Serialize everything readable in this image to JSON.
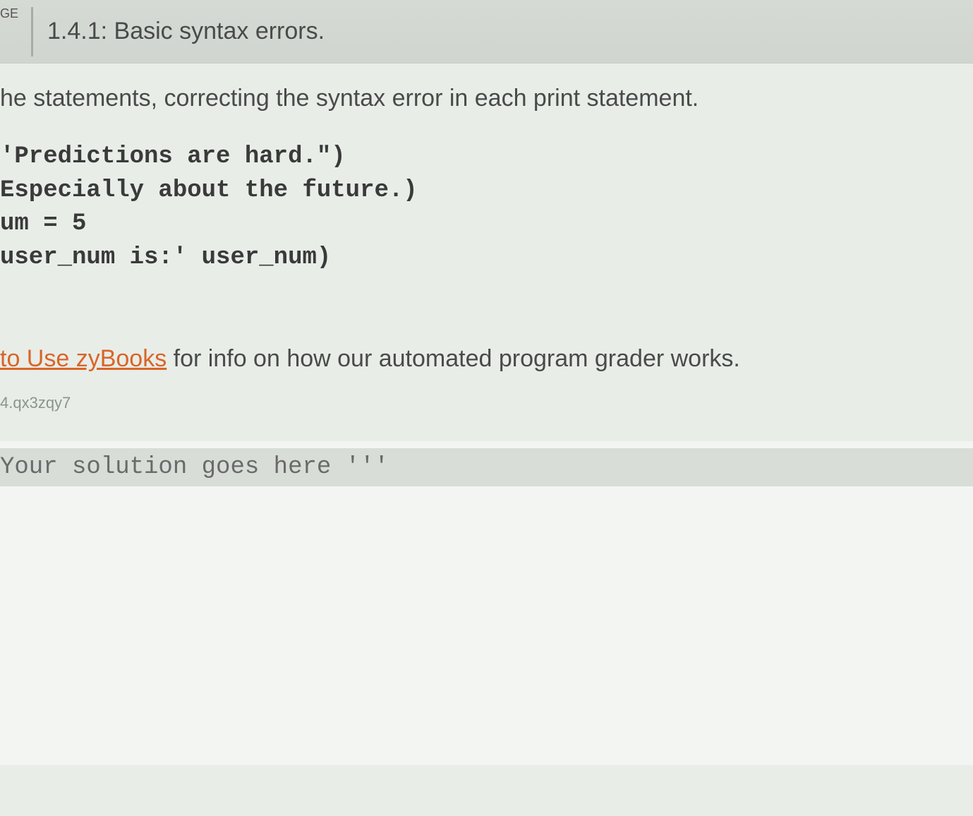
{
  "header": {
    "badge": "GE",
    "title": "1.4.1: Basic syntax errors."
  },
  "instruction": "he statements, correcting the syntax error in each print statement.",
  "code_lines": [
    "'Predictions are hard.\")",
    "Especially about the future.)",
    "um = 5",
    "user_num is:' user_num)"
  ],
  "link_section": {
    "link_text": "to Use zyBooks",
    "rest_text": " for info on how our automated program grader works."
  },
  "small_id": "4.qx3zqy7",
  "editor": {
    "placeholder_line": "Your solution goes here '''"
  }
}
